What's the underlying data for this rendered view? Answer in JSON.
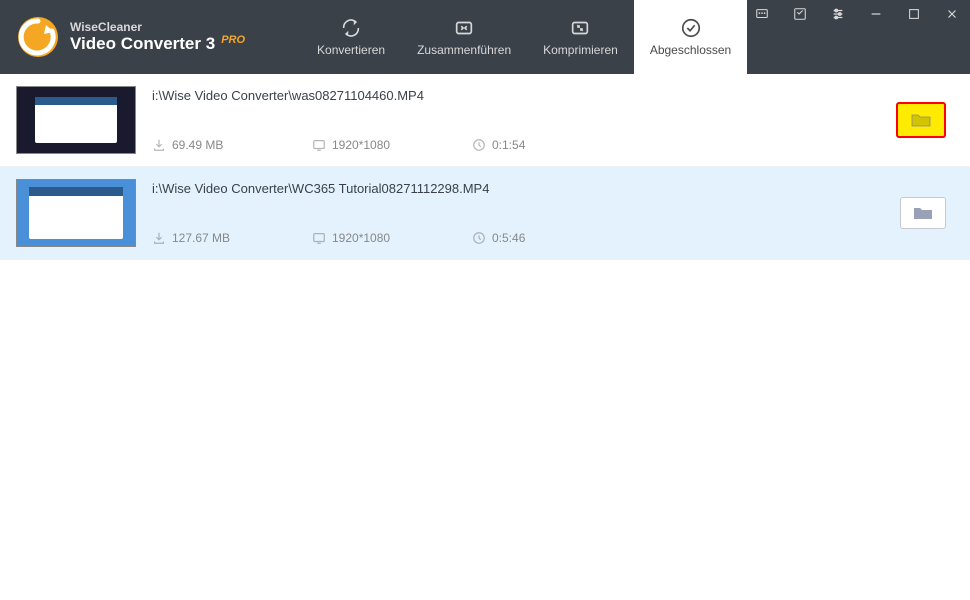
{
  "app": {
    "brand_line1": "WiseCleaner",
    "brand_line2": "Video Converter 3",
    "pro_label": "PRO"
  },
  "tabs": {
    "convert": "Konvertieren",
    "merge": "Zusammenführen",
    "compress": "Komprimieren",
    "completed": "Abgeschlossen"
  },
  "files": [
    {
      "path": "i:\\Wise Video Converter\\was08271104460.MP4",
      "size": "69.49 MB",
      "resolution": "1920*1080",
      "duration": "0:1:54"
    },
    {
      "path": "i:\\Wise Video Converter\\WC365 Tutorial08271112298.MP4",
      "size": "127.67 MB",
      "resolution": "1920*1080",
      "duration": "0:5:46"
    }
  ]
}
